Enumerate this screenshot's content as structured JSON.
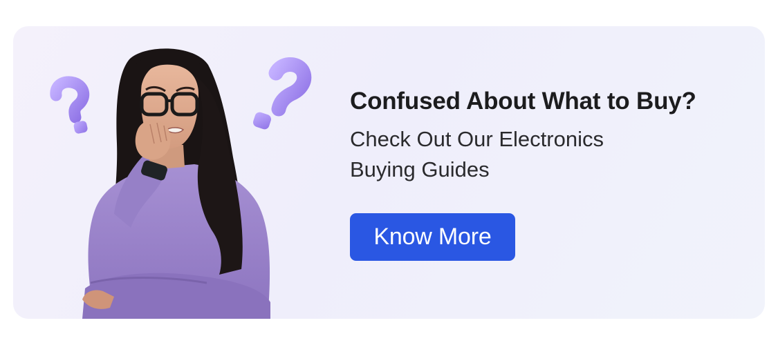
{
  "banner": {
    "headline": "Confused About What to Buy?",
    "subline": "Check Out Our Electronics Buying Guides",
    "cta_label": "Know More",
    "cta_color": "#2a57e3",
    "background_color": "#f1f0fb",
    "image": {
      "subject": "woman-with-glasses-biting-nails",
      "sweater_color": "#9b84c9",
      "question_mark_color": "#a98ef0"
    }
  }
}
